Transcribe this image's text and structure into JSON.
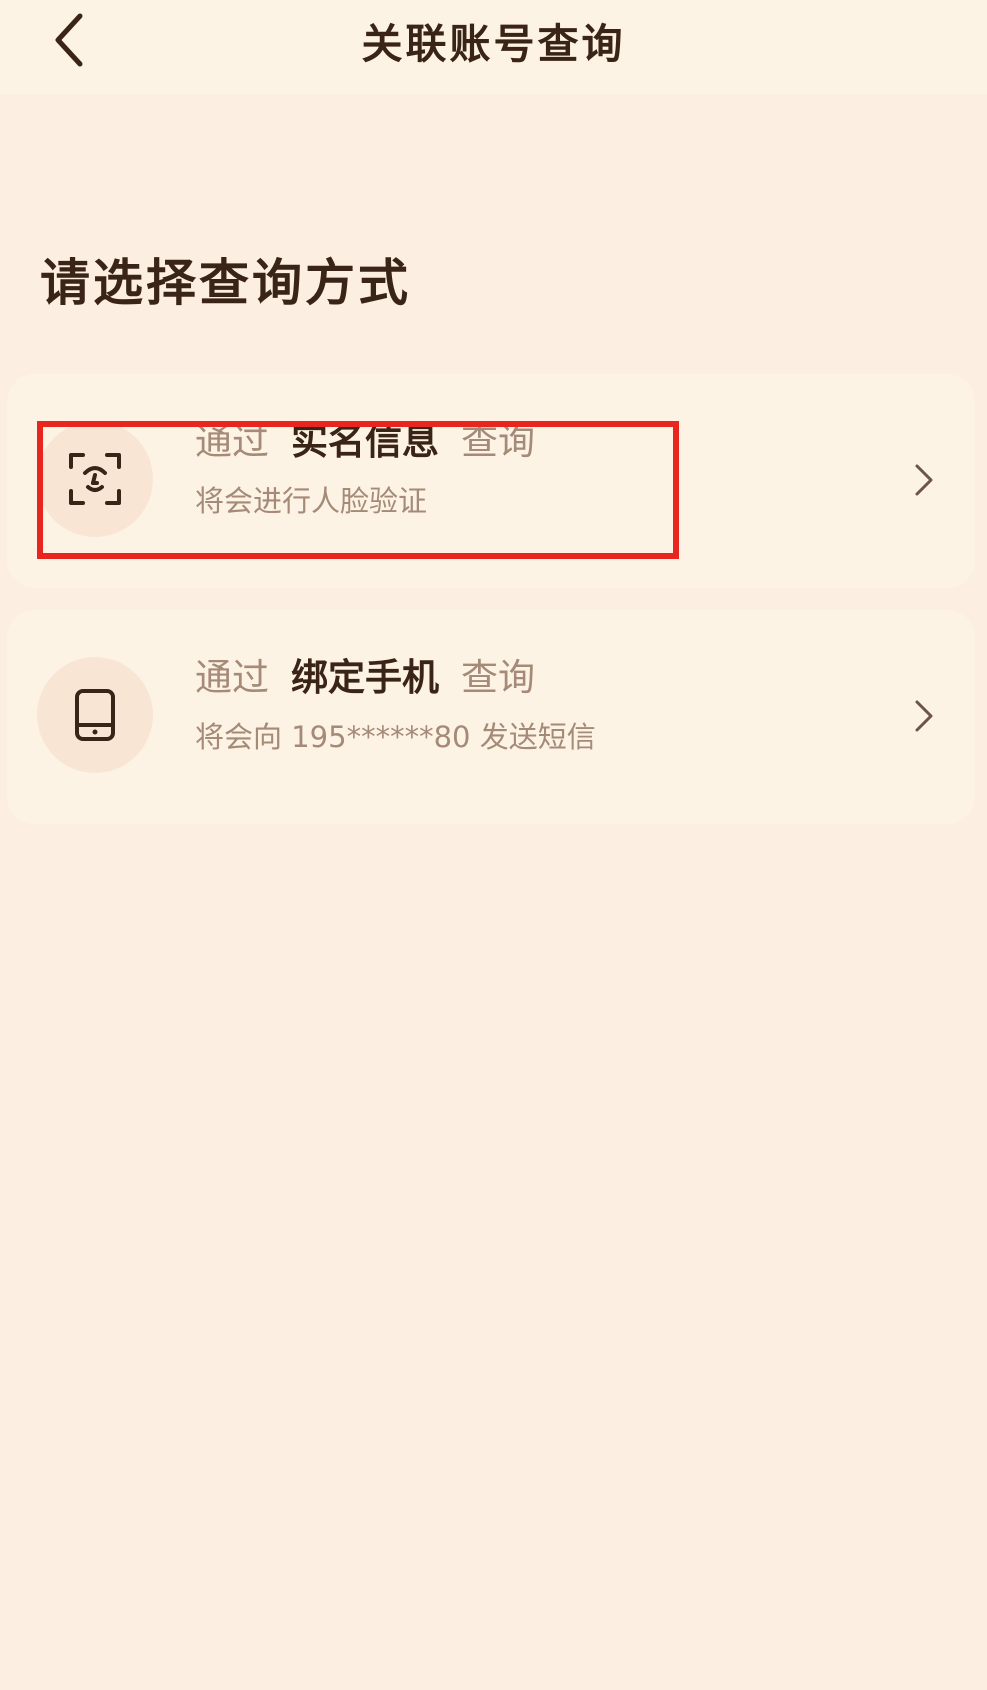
{
  "header": {
    "title": "关联账号查询",
    "back_icon": "chevron-left-icon"
  },
  "section": {
    "title": "请选择查询方式"
  },
  "options": [
    {
      "icon": "face-scan-icon",
      "prefix": "通过",
      "method": "实名信息",
      "suffix": "查询",
      "description": "将会进行人脸验证",
      "chevron_icon": "chevron-right-icon",
      "highlighted": true
    },
    {
      "icon": "phone-icon",
      "prefix": "通过",
      "method": "绑定手机",
      "suffix": "查询",
      "description": "将会向 195******80 发送短信",
      "chevron_icon": "chevron-right-icon",
      "highlighted": false
    }
  ],
  "colors": {
    "background": "#fcefe1",
    "card": "#fdf3e4",
    "icon_circle": "#f9e5d4",
    "text_dark": "#3a2418",
    "text_muted": "#a58a78",
    "highlight": "#e8261f"
  }
}
